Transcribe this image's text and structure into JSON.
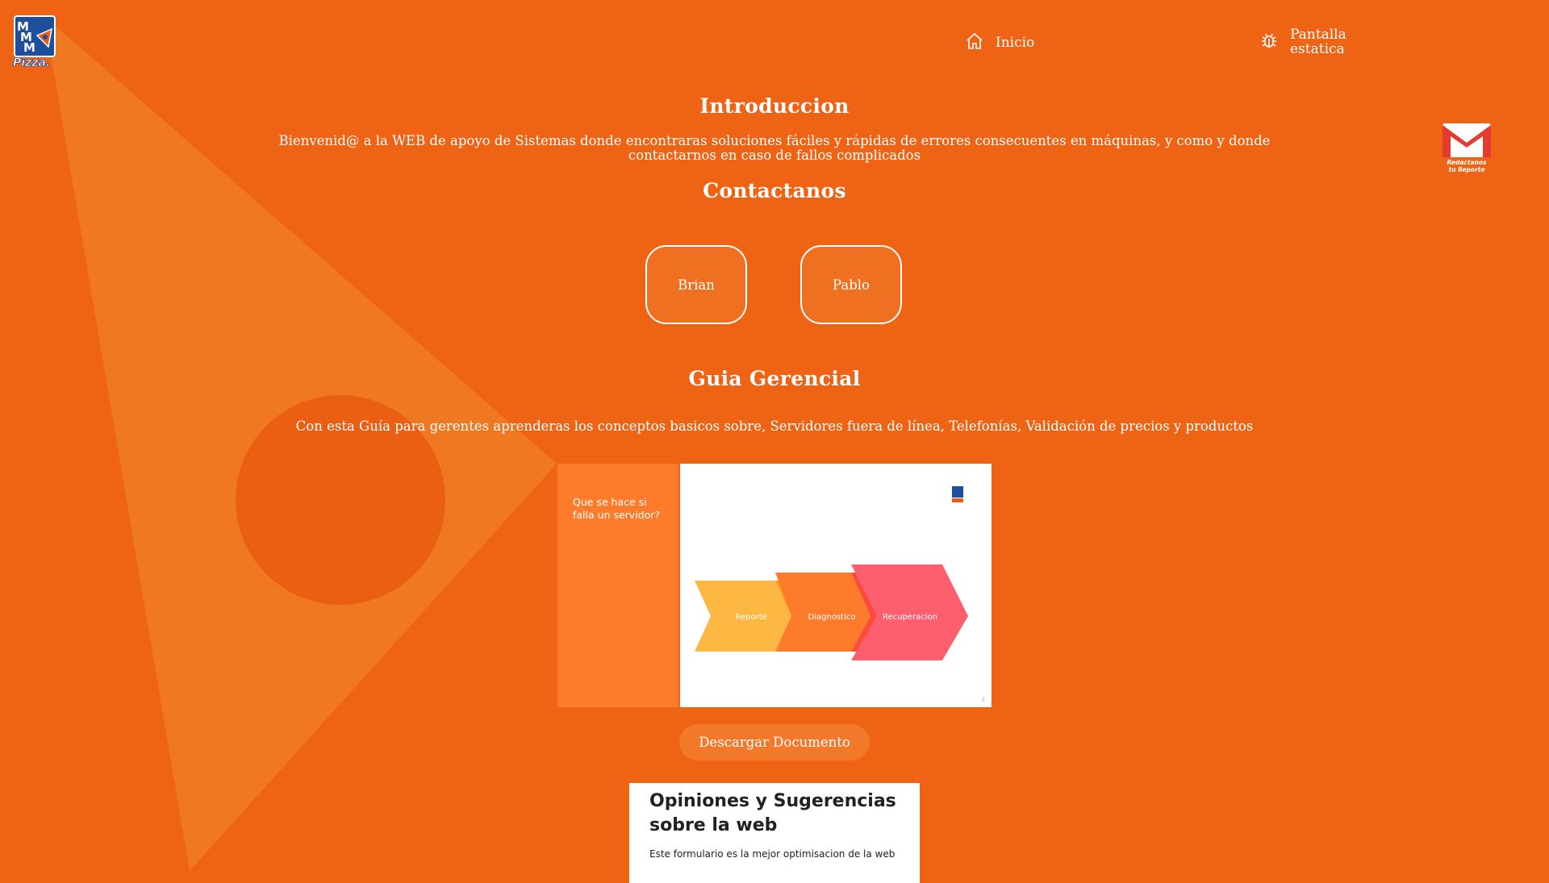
{
  "header": {
    "logo_text": "MMM Pizza",
    "nav": [
      {
        "label": "Inicio",
        "icon": "home-icon"
      },
      {
        "label": "Pantalla estatica",
        "icon": "bug-icon"
      }
    ],
    "mail_badge": {
      "caption_line1": "Redactanos",
      "caption_line2": "tu Reporte",
      "icon": "mail-icon"
    }
  },
  "intro": {
    "title": "Introduccion",
    "text": "Bienvenid@ a la WEB de apoyo de Sistemas donde encontraras soluciones fáciles y rápidas de errores consecuentes en máquinas, y como y donde contactarnos en caso de fallos complicados"
  },
  "contact": {
    "title": "Contactanos",
    "buttons": [
      "Brian",
      "Pablo"
    ]
  },
  "guide": {
    "title": "Guia Gerencial",
    "text": "Con esta Guía para gerentes aprenderas los conceptos basicos sobre, Servidores fuera de línea, Telefonías, Validación de precios y productos",
    "slide": {
      "side_text": "Que se hace si falla un servidor?",
      "steps": [
        "Reporte",
        "Diagnostico",
        "Recuperacion"
      ],
      "page_number": "2"
    },
    "download_label": "Descargar Documento"
  },
  "form": {
    "title": "Opiniones y Sugerencias sobre la web",
    "description": "Este formulario es la mejor optimisacion de la web"
  },
  "colors": {
    "background": "#ef6314",
    "accent_light": "#f07a22",
    "step1": "#fdb843",
    "step2": "#fe7b2c",
    "step3": "#fe5f6e"
  }
}
